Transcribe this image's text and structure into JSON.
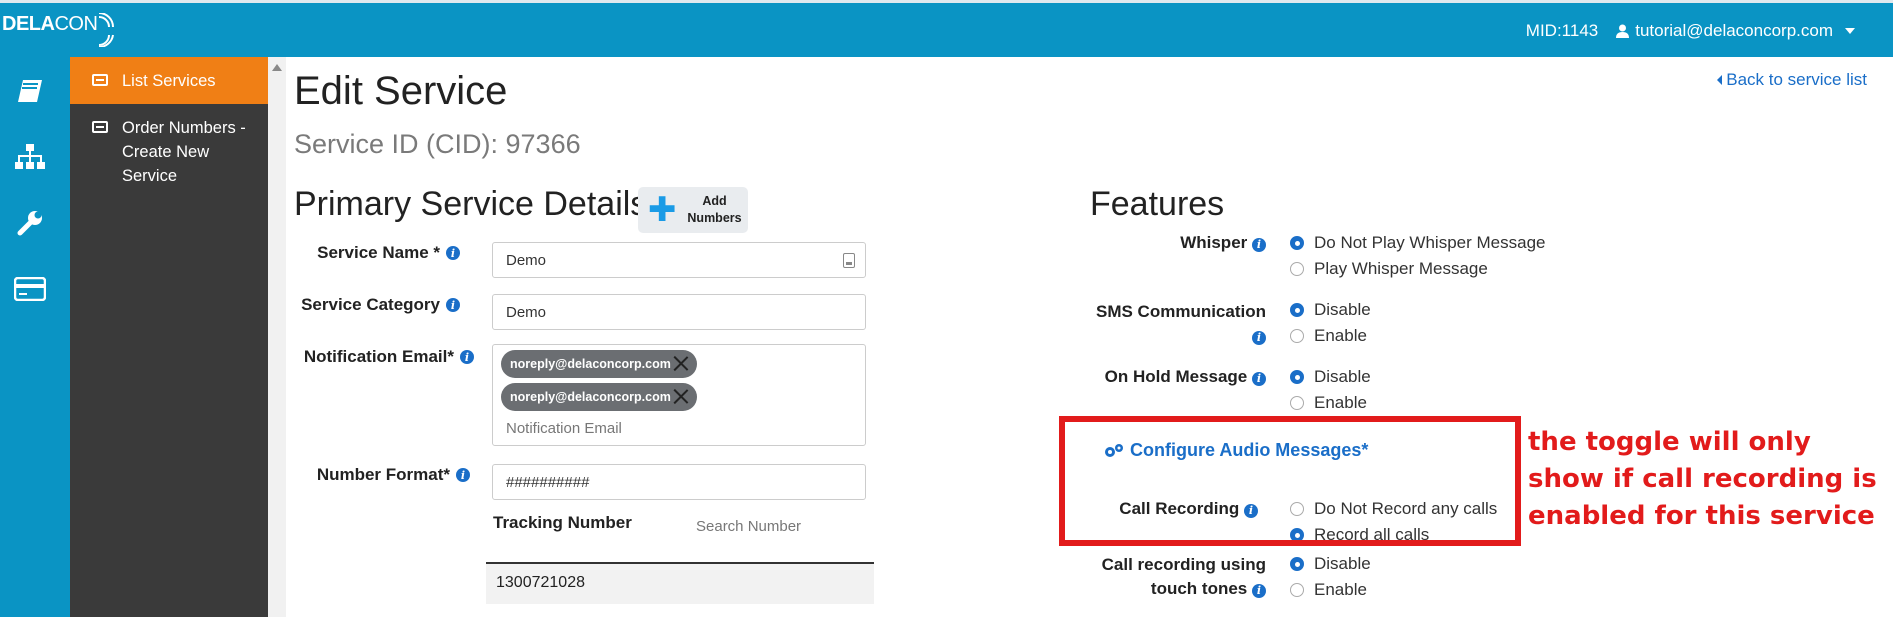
{
  "header": {
    "logo_bold": "DELA",
    "logo_light": "CON",
    "mid": "MID:1143",
    "user_email": "tutorial@delaconcorp.com"
  },
  "icon_rail": {
    "icons": [
      "book-icon",
      "sitemap-icon",
      "wrench-icon",
      "credit-card-icon"
    ]
  },
  "subnav": {
    "items": [
      {
        "label": "List Services",
        "active": true
      },
      {
        "label": "Order Numbers - Create New Service",
        "active": false
      }
    ]
  },
  "page": {
    "title": "Edit Service",
    "service_id": "Service ID (CID): 97366",
    "back_link": "Back to service list"
  },
  "primary": {
    "title": "Primary Service Details",
    "add_numbers": "Add Numbers",
    "service_name_label": "Service Name *",
    "service_name_value": "Demo",
    "service_category_label": "Service Category",
    "service_category_value": "Demo",
    "notification_email_label": "Notification Email*",
    "emails": [
      "noreply@delaconcorp.com",
      "noreply@delaconcorp.com"
    ],
    "notification_email_placeholder": "Notification Email",
    "number_format_label": "Number Format*",
    "number_format_value": "##########",
    "tracking_header": "Tracking Number",
    "search_placeholder": "Search Number",
    "tracking_numbers": [
      "1300721028"
    ]
  },
  "features": {
    "title": "Features",
    "whisper": {
      "label": "Whisper",
      "options": [
        "Do Not Play Whisper Message",
        "Play Whisper Message"
      ],
      "selected": 0
    },
    "sms": {
      "label": "SMS Communication",
      "options": [
        "Disable",
        "Enable"
      ],
      "selected": 0
    },
    "on_hold": {
      "label": "On Hold Message",
      "options": [
        "Disable",
        "Enable"
      ],
      "selected": 0
    },
    "configure_audio": "Configure Audio Messages*",
    "call_recording": {
      "label": "Call Recording",
      "options": [
        "Do Not Record any calls",
        "Record all calls"
      ],
      "selected": 1
    },
    "touch_tones": {
      "label_line1": "Call recording using",
      "label_line2": "touch tones",
      "options": [
        "Disable",
        "Enable"
      ],
      "selected": 0
    }
  },
  "annotation": {
    "text": "the toggle will only show if call recording is enabled for this service",
    "color": "#e21b1b"
  },
  "colors": {
    "topbar": "#0a94c4",
    "active_nav": "#f07f15",
    "subnav_bg": "#3a3a3a",
    "link": "#1a6ec8"
  }
}
